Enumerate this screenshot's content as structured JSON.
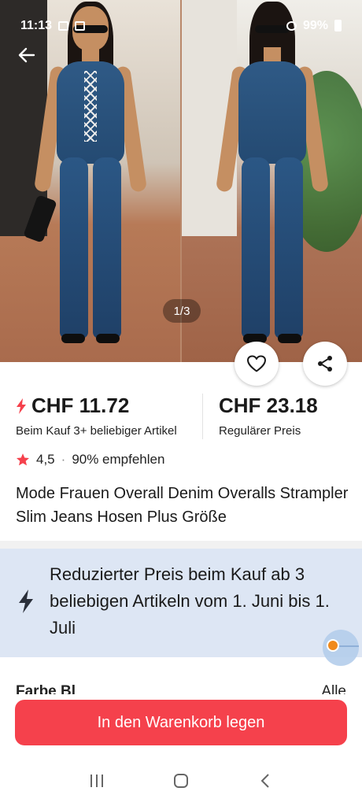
{
  "status_bar": {
    "time": "11:13",
    "battery": "99%"
  },
  "gallery": {
    "counter": "1/3"
  },
  "pricing": {
    "sale_price": "CHF 11.72",
    "sale_condition": "Beim Kauf 3+ beliebiger Artikel",
    "regular_price": "CHF 23.18",
    "regular_label": "Regulärer Preis"
  },
  "rating": {
    "score": "4,5",
    "separator": "·",
    "recommend": "90% empfehlen"
  },
  "product": {
    "title": "Mode Frauen Overall Denim Overalls Strampler Slim Jeans Hosen Plus Größe"
  },
  "promo": {
    "text": "Reduzierter Preis beim Kauf ab 3 beliebigen Artikeln vom 1. Juni bis 1. Juli"
  },
  "section_peek": {
    "left": "Farbe Bl",
    "right": "Alle"
  },
  "cart": {
    "button_label": "In den Warenkorb legen"
  },
  "icons": {
    "back": "arrow-left-icon",
    "wishlist": "heart-icon",
    "share": "share-icon",
    "sale": "lightning-icon",
    "star": "star-icon",
    "promo": "lightning-icon",
    "nav_recent": "recent-apps-icon",
    "nav_home": "home-icon",
    "nav_back": "back-chevron-icon"
  },
  "colors": {
    "accent": "#f5414c",
    "promo_bg": "#dde6f4",
    "star": "#f5414c"
  }
}
